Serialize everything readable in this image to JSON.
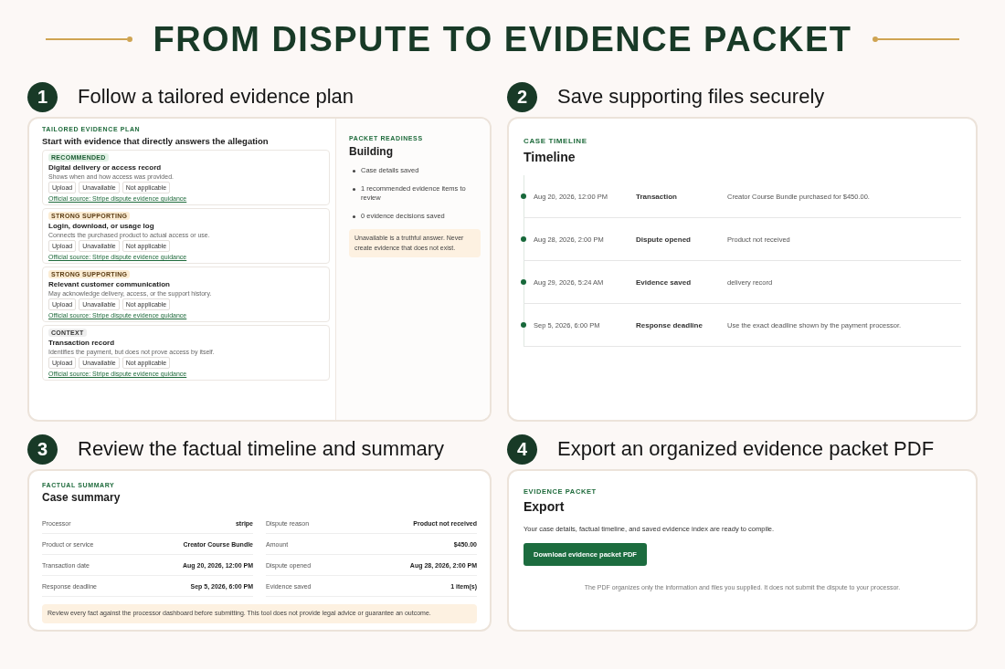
{
  "title": "FROM DISPUTE TO EVIDENCE PACKET",
  "steps": [
    {
      "kind": "plan",
      "number": "1",
      "heading": "Follow a tailored evidence plan",
      "eyebrow": "TAILORED EVIDENCE PLAN",
      "title": "Start with evidence that directly answers the allegation",
      "items": [
        {
          "badge": {
            "kind": "recommended",
            "label": "RECOMMENDED"
          },
          "title": "Digital delivery or access record",
          "description": "Shows when and how access was provided.",
          "actions": [
            "Upload",
            "Unavailable",
            "Not applicable"
          ],
          "link": "Official source: Stripe dispute evidence guidance"
        },
        {
          "badge": {
            "kind": "strong",
            "label": "STRONG SUPPORTING"
          },
          "title": "Login, download, or usage log",
          "description": "Connects the purchased product to actual access or use.",
          "actions": [
            "Upload",
            "Unavailable",
            "Not applicable"
          ],
          "link": "Official source: Stripe dispute evidence guidance"
        },
        {
          "badge": {
            "kind": "strong",
            "label": "STRONG SUPPORTING"
          },
          "title": "Relevant customer communication",
          "description": "May acknowledge delivery, access, or the support history.",
          "actions": [
            "Upload",
            "Unavailable",
            "Not applicable"
          ],
          "link": "Official source: Stripe dispute evidence guidance"
        },
        {
          "badge": {
            "kind": "context",
            "label": "CONTEXT"
          },
          "title": "Transaction record",
          "description": "Identifies the payment, but does not prove access by itself.",
          "actions": [
            "Upload",
            "Unavailable",
            "Not applicable"
          ],
          "link": "Official source: Stripe dispute evidence guidance"
        }
      ],
      "readiness": {
        "eyebrow": "PACKET READINESS",
        "title": "Building",
        "bullets": [
          "Case details saved",
          "1 recommended evidence items to review",
          "0 evidence decisions saved"
        ],
        "note": "Unavailable is a truthful answer. Never create evidence that does not exist."
      }
    },
    {
      "kind": "timeline",
      "number": "2",
      "heading": "Save supporting files securely",
      "eyebrow": "CASE TIMELINE",
      "title": "Timeline",
      "events": [
        {
          "time": "Aug 20, 2026, 12:00 PM",
          "label": "Transaction",
          "detail": "Creator Course Bundle purchased for $450.00."
        },
        {
          "time": "Aug 28, 2026, 2:00 PM",
          "label": "Dispute opened",
          "detail": "Product not received"
        },
        {
          "time": "Aug 29, 2026, 5:24 AM",
          "label": "Evidence saved",
          "detail": "delivery record"
        },
        {
          "time": "Sep 5, 2026, 6:00 PM",
          "label": "Response deadline",
          "detail": "Use the exact deadline shown by the payment processor."
        }
      ]
    },
    {
      "kind": "summary",
      "number": "3",
      "heading": "Review the factual timeline and summary",
      "eyebrow": "FACTUAL SUMMARY",
      "title": "Case summary",
      "rows": [
        {
          "label": "Processor",
          "value": "stripe"
        },
        {
          "label": "Dispute reason",
          "value": "Product not received"
        },
        {
          "label": "Product or service",
          "value": "Creator Course Bundle"
        },
        {
          "label": "Amount",
          "value": "$450.00"
        },
        {
          "label": "Transaction date",
          "value": "Aug 20, 2026, 12:00 PM"
        },
        {
          "label": "Dispute opened",
          "value": "Aug 28, 2026, 2:00 PM"
        },
        {
          "label": "Response deadline",
          "value": "Sep 5, 2026, 6:00 PM"
        },
        {
          "label": "Evidence saved",
          "value": "1 item(s)"
        }
      ],
      "note": "Review every fact against the processor dashboard before submitting. This tool does not provide legal advice or guarantee an outcome."
    },
    {
      "kind": "export",
      "number": "4",
      "heading": "Export an organized evidence packet PDF",
      "eyebrow": "EVIDENCE PACKET",
      "title": "Export",
      "text": "Your case details, factual timeline, and saved evidence index are ready to compile.",
      "button": "Download evidence packet PDF",
      "note": "The PDF organizes only the information and files you supplied. It does not submit the dispute to your processor."
    }
  ]
}
